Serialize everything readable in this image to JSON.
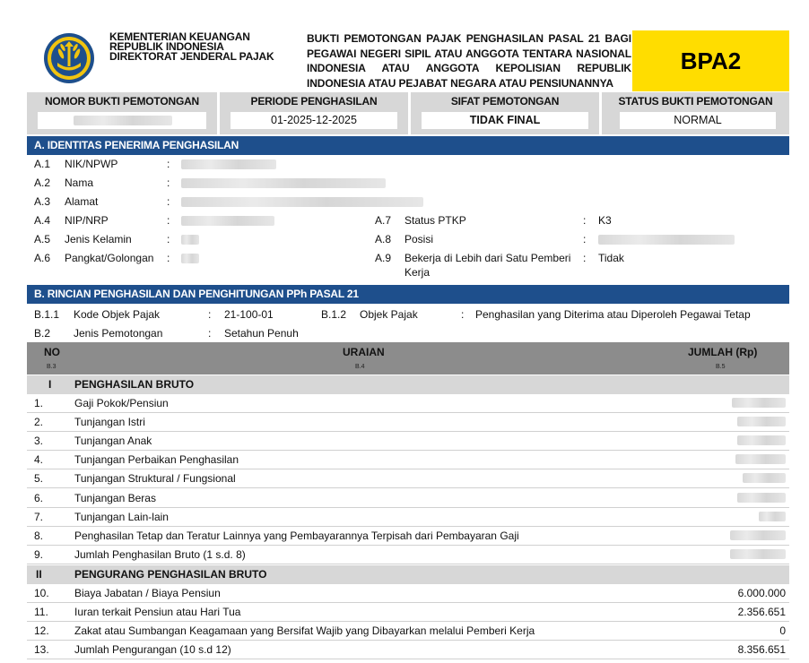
{
  "header": {
    "agency_lines": [
      "KEMENTERIAN KEUANGAN",
      "REPUBLIK INDONESIA",
      "DIREKTORAT JENDERAL PAJAK"
    ],
    "title": "BUKTI PEMOTONGAN PAJAK PENGHASILAN PASAL 21 BAGI PEGAWAI NEGERI SIPIL ATAU ANGGOTA TENTARA NASIONAL INDONESIA ATAU ANGGOTA KEPOLISIAN REPUBLIK INDONESIA ATAU PEJABAT NEGARA ATAU PENSIUNANNYA",
    "form_code": "BPA2",
    "form_code_color": "#FFDD00"
  },
  "infobar": {
    "nomor_label": "NOMOR BUKTI PEMOTONGAN",
    "nomor_value": "",
    "periode_label": "PERIODE PENGHASILAN",
    "periode_value": "01-2025-12-2025",
    "sifat_label": "SIFAT PEMOTONGAN",
    "sifat_value": "TIDAK FINAL",
    "status_label": "STATUS BUKTI PEMOTONGAN",
    "status_value": "NORMAL"
  },
  "section_a": {
    "title": "A. IDENTITAS PENERIMA PENGHASILAN",
    "rows_left": [
      {
        "code": "A.1",
        "label": "NIK/NPWP",
        "value": ""
      },
      {
        "code": "A.2",
        "label": "Nama",
        "value": ""
      },
      {
        "code": "A.3",
        "label": "Alamat",
        "value": ""
      },
      {
        "code": "A.4",
        "label": "NIP/NRP",
        "value": ""
      },
      {
        "code": "A.5",
        "label": "Jenis Kelamin",
        "value": ""
      },
      {
        "code": "A.6",
        "label": "Pangkat/Golongan",
        "value": ""
      }
    ],
    "rows_right": [
      {
        "code": "A.7",
        "label": "Status PTKP",
        "value": "K3"
      },
      {
        "code": "A.8",
        "label": "Posisi",
        "value": ""
      },
      {
        "code": "A.9",
        "label": "Bekerja di Lebih dari Satu Pemberi",
        "label2": "Kerja",
        "value": "Tidak"
      }
    ],
    "colon": ":"
  },
  "section_b": {
    "title": "B. RINCIAN PENGHASILAN DAN PENGHITUNGAN PPh PASAL 21",
    "kode_code": "B.1.1",
    "kode_label": "Kode Objek Pajak",
    "kode_value": "21-100-01",
    "objek_code": "B.1.2",
    "objek_label": "Objek Pajak",
    "objek_value": "Penghasilan yang Diterima atau Diperoleh Pegawai Tetap",
    "jenis_code": "B.2",
    "jenis_label": "Jenis Pemotongan",
    "jenis_value": "Setahun Penuh",
    "colon": ":"
  },
  "table": {
    "col_no": "NO",
    "col_no_sub": "B.3",
    "col_uraian": "URAIAN",
    "col_uraian_sub": "B.4",
    "col_jumlah": "JUMLAH (Rp)",
    "col_jumlah_sub": "B.5",
    "group1_no": "I",
    "group1_title": "PENGHASILAN BRUTO",
    "group1_rows": [
      {
        "no": "1.",
        "label": "Gaji Pokok/Pensiun",
        "amount": ""
      },
      {
        "no": "2.",
        "label": "Tunjangan Istri",
        "amount": ""
      },
      {
        "no": "3.",
        "label": "Tunjangan Anak",
        "amount": ""
      },
      {
        "no": "4.",
        "label": "Tunjangan Perbaikan Penghasilan",
        "amount": ""
      },
      {
        "no": "5.",
        "label": "Tunjangan Struktural / Fungsional",
        "amount": ""
      },
      {
        "no": "6.",
        "label": "Tunjangan Beras",
        "amount": ""
      },
      {
        "no": "7.",
        "label": "Tunjangan Lain-lain",
        "amount": ""
      },
      {
        "no": "8.",
        "label": "Penghasilan Tetap dan Teratur Lainnya yang Pembayarannya Terpisah dari Pembayaran Gaji",
        "amount": ""
      },
      {
        "no": "9.",
        "label": "Jumlah Penghasilan Bruto (1 s.d. 8)",
        "amount": ""
      }
    ],
    "group2_no": "II",
    "group2_title": "PENGURANG PENGHASILAN BRUTO",
    "group2_rows": [
      {
        "no": "10.",
        "label": "Biaya Jabatan / Biaya Pensiun",
        "amount": "6.000.000"
      },
      {
        "no": "11.",
        "label": "Iuran terkait Pensiun atau Hari Tua",
        "amount": "2.356.651"
      },
      {
        "no": "12.",
        "label": "Zakat atau Sumbangan Keagamaan yang Bersifat Wajib yang Dibayarkan melalui Pemberi Kerja",
        "amount": "0"
      },
      {
        "no": "13.",
        "label": "Jumlah Pengurangan (10 s.d 12)",
        "amount": "8.356.651"
      }
    ]
  }
}
